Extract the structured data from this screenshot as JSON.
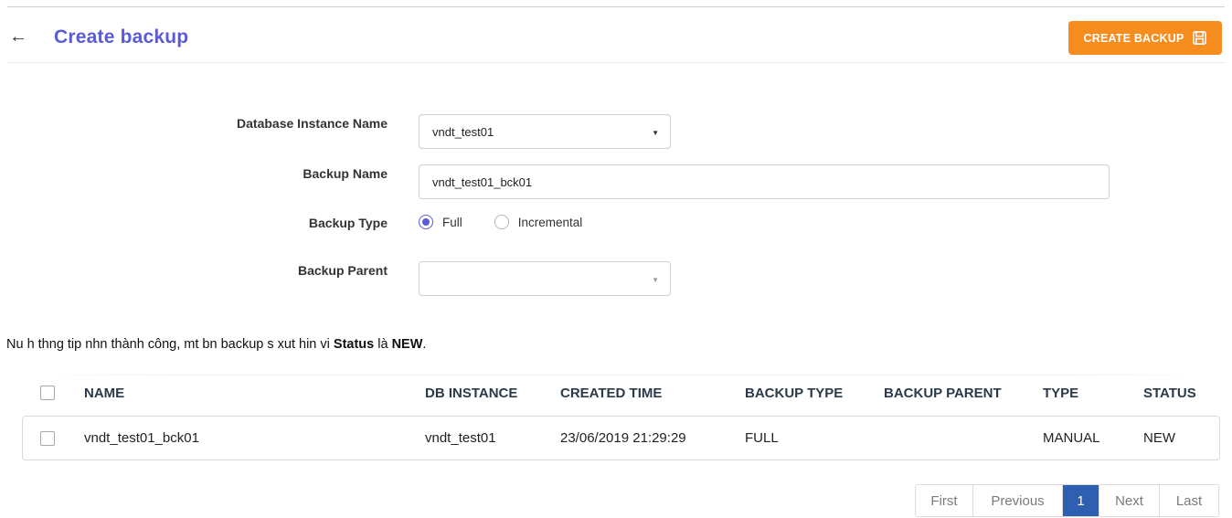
{
  "header": {
    "back_icon": "←",
    "title": "Create backup",
    "create_label": "CREATE BACKUP"
  },
  "form": {
    "instance_label": "Database Instance Name",
    "instance_value": "vndt_test01",
    "backup_name_label": "Backup Name",
    "backup_name_value": "vndt_test01_bck01",
    "backup_type_label": "Backup Type",
    "type_options": [
      "Full",
      "Incremental"
    ],
    "type_selected": "Full",
    "backup_parent_label": "Backup Parent",
    "backup_parent_value": ""
  },
  "note": {
    "prefix": "Nu h thng tip nhn thành công, mt bn backup s xut hin vi ",
    "status_word": "Status",
    "middle": " là ",
    "new_word": "NEW",
    "suffix": "."
  },
  "table": {
    "columns": [
      "NAME",
      "DB INSTANCE",
      "CREATED TIME",
      "BACKUP TYPE",
      "BACKUP PARENT",
      "TYPE",
      "STATUS"
    ],
    "rows": [
      [
        "vndt_test01_bck01",
        "vndt_test01",
        "23/06/2019 21:29:29",
        "FULL",
        "",
        "MANUAL",
        "NEW"
      ]
    ]
  },
  "pagination": {
    "first": "First",
    "previous": "Previous",
    "current": "1",
    "next": "Next",
    "last": "Last"
  },
  "colors": {
    "accent": "#5b5bd6",
    "create_button": "#f78c1f",
    "page_active": "#2f5fb0"
  },
  "icons": {
    "back": "arrow-left-icon",
    "create": "save-icon",
    "dropdown": "caret-down-icon"
  }
}
